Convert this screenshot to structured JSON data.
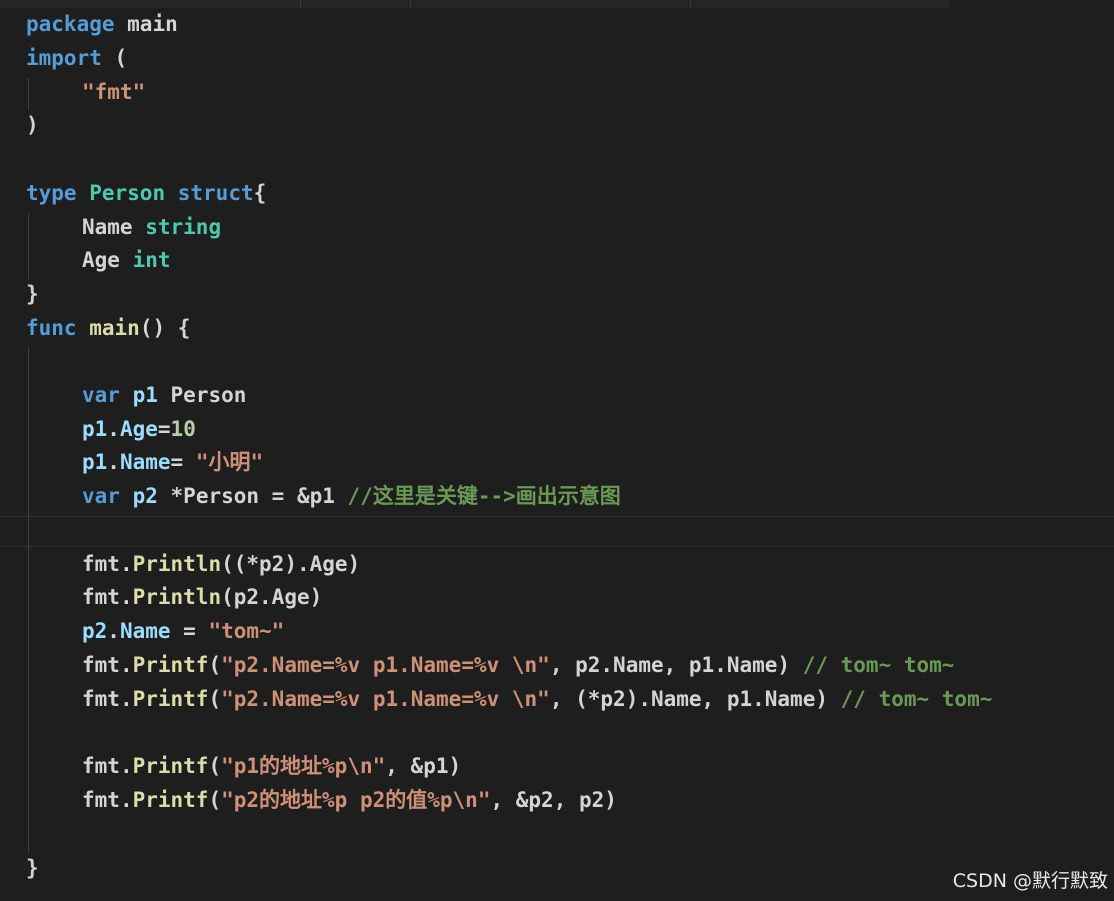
{
  "code": {
    "l1": [
      "package",
      " main"
    ],
    "l2": [
      "import",
      " ("
    ],
    "l3": [
      "\"fmt\""
    ],
    "l4": [
      ")"
    ],
    "l6": [
      "type",
      " ",
      "Person",
      " ",
      "struct",
      "{"
    ],
    "l7": [
      "Name",
      " ",
      "string"
    ],
    "l8": [
      "Age",
      " ",
      "int"
    ],
    "l9": [
      "}"
    ],
    "l10": [
      "func",
      " ",
      "main",
      "() {"
    ],
    "l12": [
      "var",
      " ",
      "p1",
      " Person"
    ],
    "l13": [
      "p1",
      ".",
      "Age",
      "=",
      "10"
    ],
    "l14": [
      "p1",
      ".",
      "Name",
      "= ",
      "\"小明\""
    ],
    "l15": [
      "var",
      " ",
      "p2",
      " *Person = &p1 ",
      "//这里是关键-->画出示意图"
    ],
    "l17": [
      "fmt",
      ".",
      "Println",
      "((*p2).Age)"
    ],
    "l18": [
      "fmt",
      ".",
      "Println",
      "(p2.Age)"
    ],
    "l19": [
      "p2",
      ".",
      "Name",
      " = ",
      "\"tom~\""
    ],
    "l20": [
      "fmt",
      ".",
      "Printf",
      "(",
      "\"p2.Name=%v p1.Name=%v \\n\"",
      ", p2.Name, p1.Name) ",
      "// tom~ tom~"
    ],
    "l21": [
      "fmt",
      ".",
      "Printf",
      "(",
      "\"p2.Name=%v p1.Name=%v \\n\"",
      ", (*p2).Name, p1.Name) ",
      "// tom~ tom~"
    ],
    "l23": [
      "fmt",
      ".",
      "Printf",
      "(",
      "\"p1的地址%p\\n\"",
      ", &p1)"
    ],
    "l24": [
      "fmt",
      ".",
      "Printf",
      "(",
      "\"p2的地址%p p2的值%p\\n\"",
      ", &p2, p2)"
    ],
    "l26": [
      "}"
    ]
  },
  "watermark": "CSDN @默行默致",
  "colors": {
    "background": "#1e1e1e",
    "keyword": "#569cd6",
    "type": "#4ec9b0",
    "function": "#dcdcaa",
    "variable": "#9cdcfe",
    "string": "#ce9178",
    "number": "#b5cea8",
    "comment": "#6a9955",
    "text": "#d4d4d4"
  }
}
